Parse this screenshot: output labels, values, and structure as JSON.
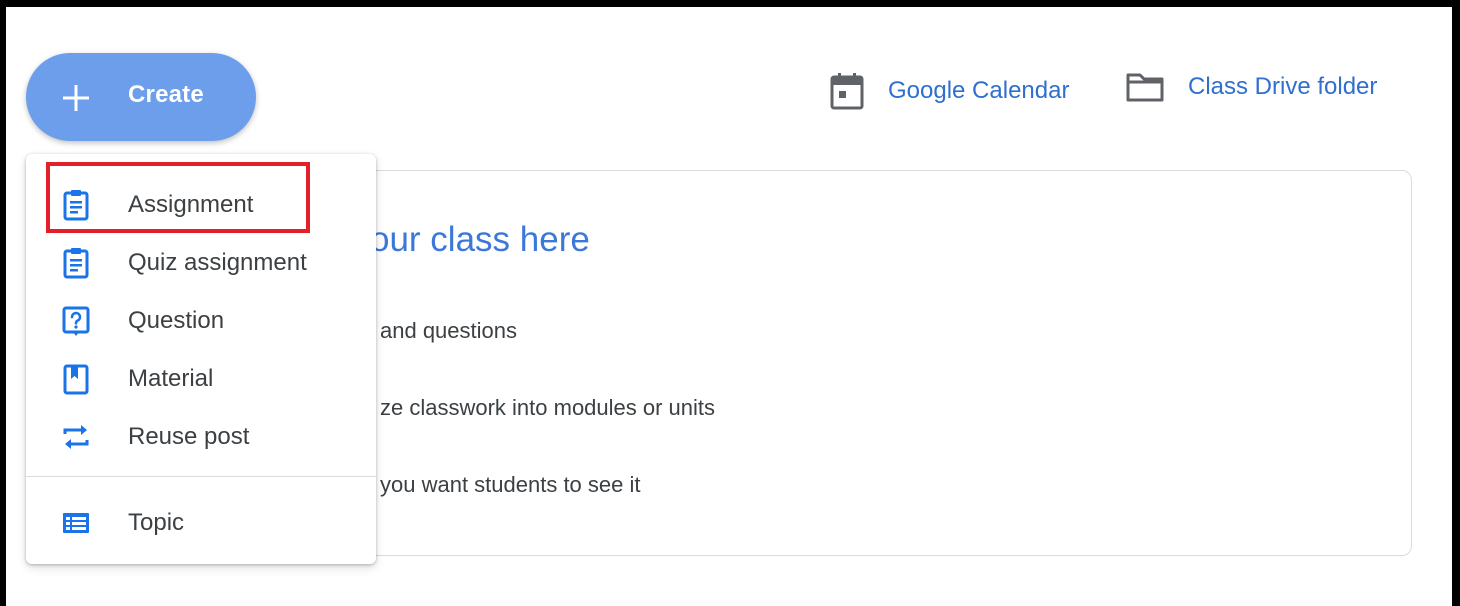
{
  "create_button": {
    "label": "Create",
    "icon": "plus-icon"
  },
  "toplinks": {
    "calendar": {
      "label": "Google Calendar",
      "icon": "calendar-icon"
    },
    "drive": {
      "label": "Class Drive folder",
      "icon": "folder-icon"
    }
  },
  "card": {
    "title": "our class here",
    "lines": [
      "and questions",
      "ze classwork into modules or units",
      "you want students to see it"
    ]
  },
  "menu": {
    "items": [
      {
        "label": "Assignment",
        "icon": "assignment-icon"
      },
      {
        "label": "Quiz assignment",
        "icon": "quiz-assignment-icon"
      },
      {
        "label": "Question",
        "icon": "question-icon"
      },
      {
        "label": "Material",
        "icon": "material-icon"
      },
      {
        "label": "Reuse post",
        "icon": "reuse-icon"
      },
      {
        "label": "Topic",
        "icon": "topic-icon"
      }
    ]
  },
  "colors": {
    "accent_blue": "#2f6fcf",
    "create_button_bg": "#6d9eeb",
    "icon_blue": "#1a73e8",
    "highlight_red": "#e3202a"
  }
}
